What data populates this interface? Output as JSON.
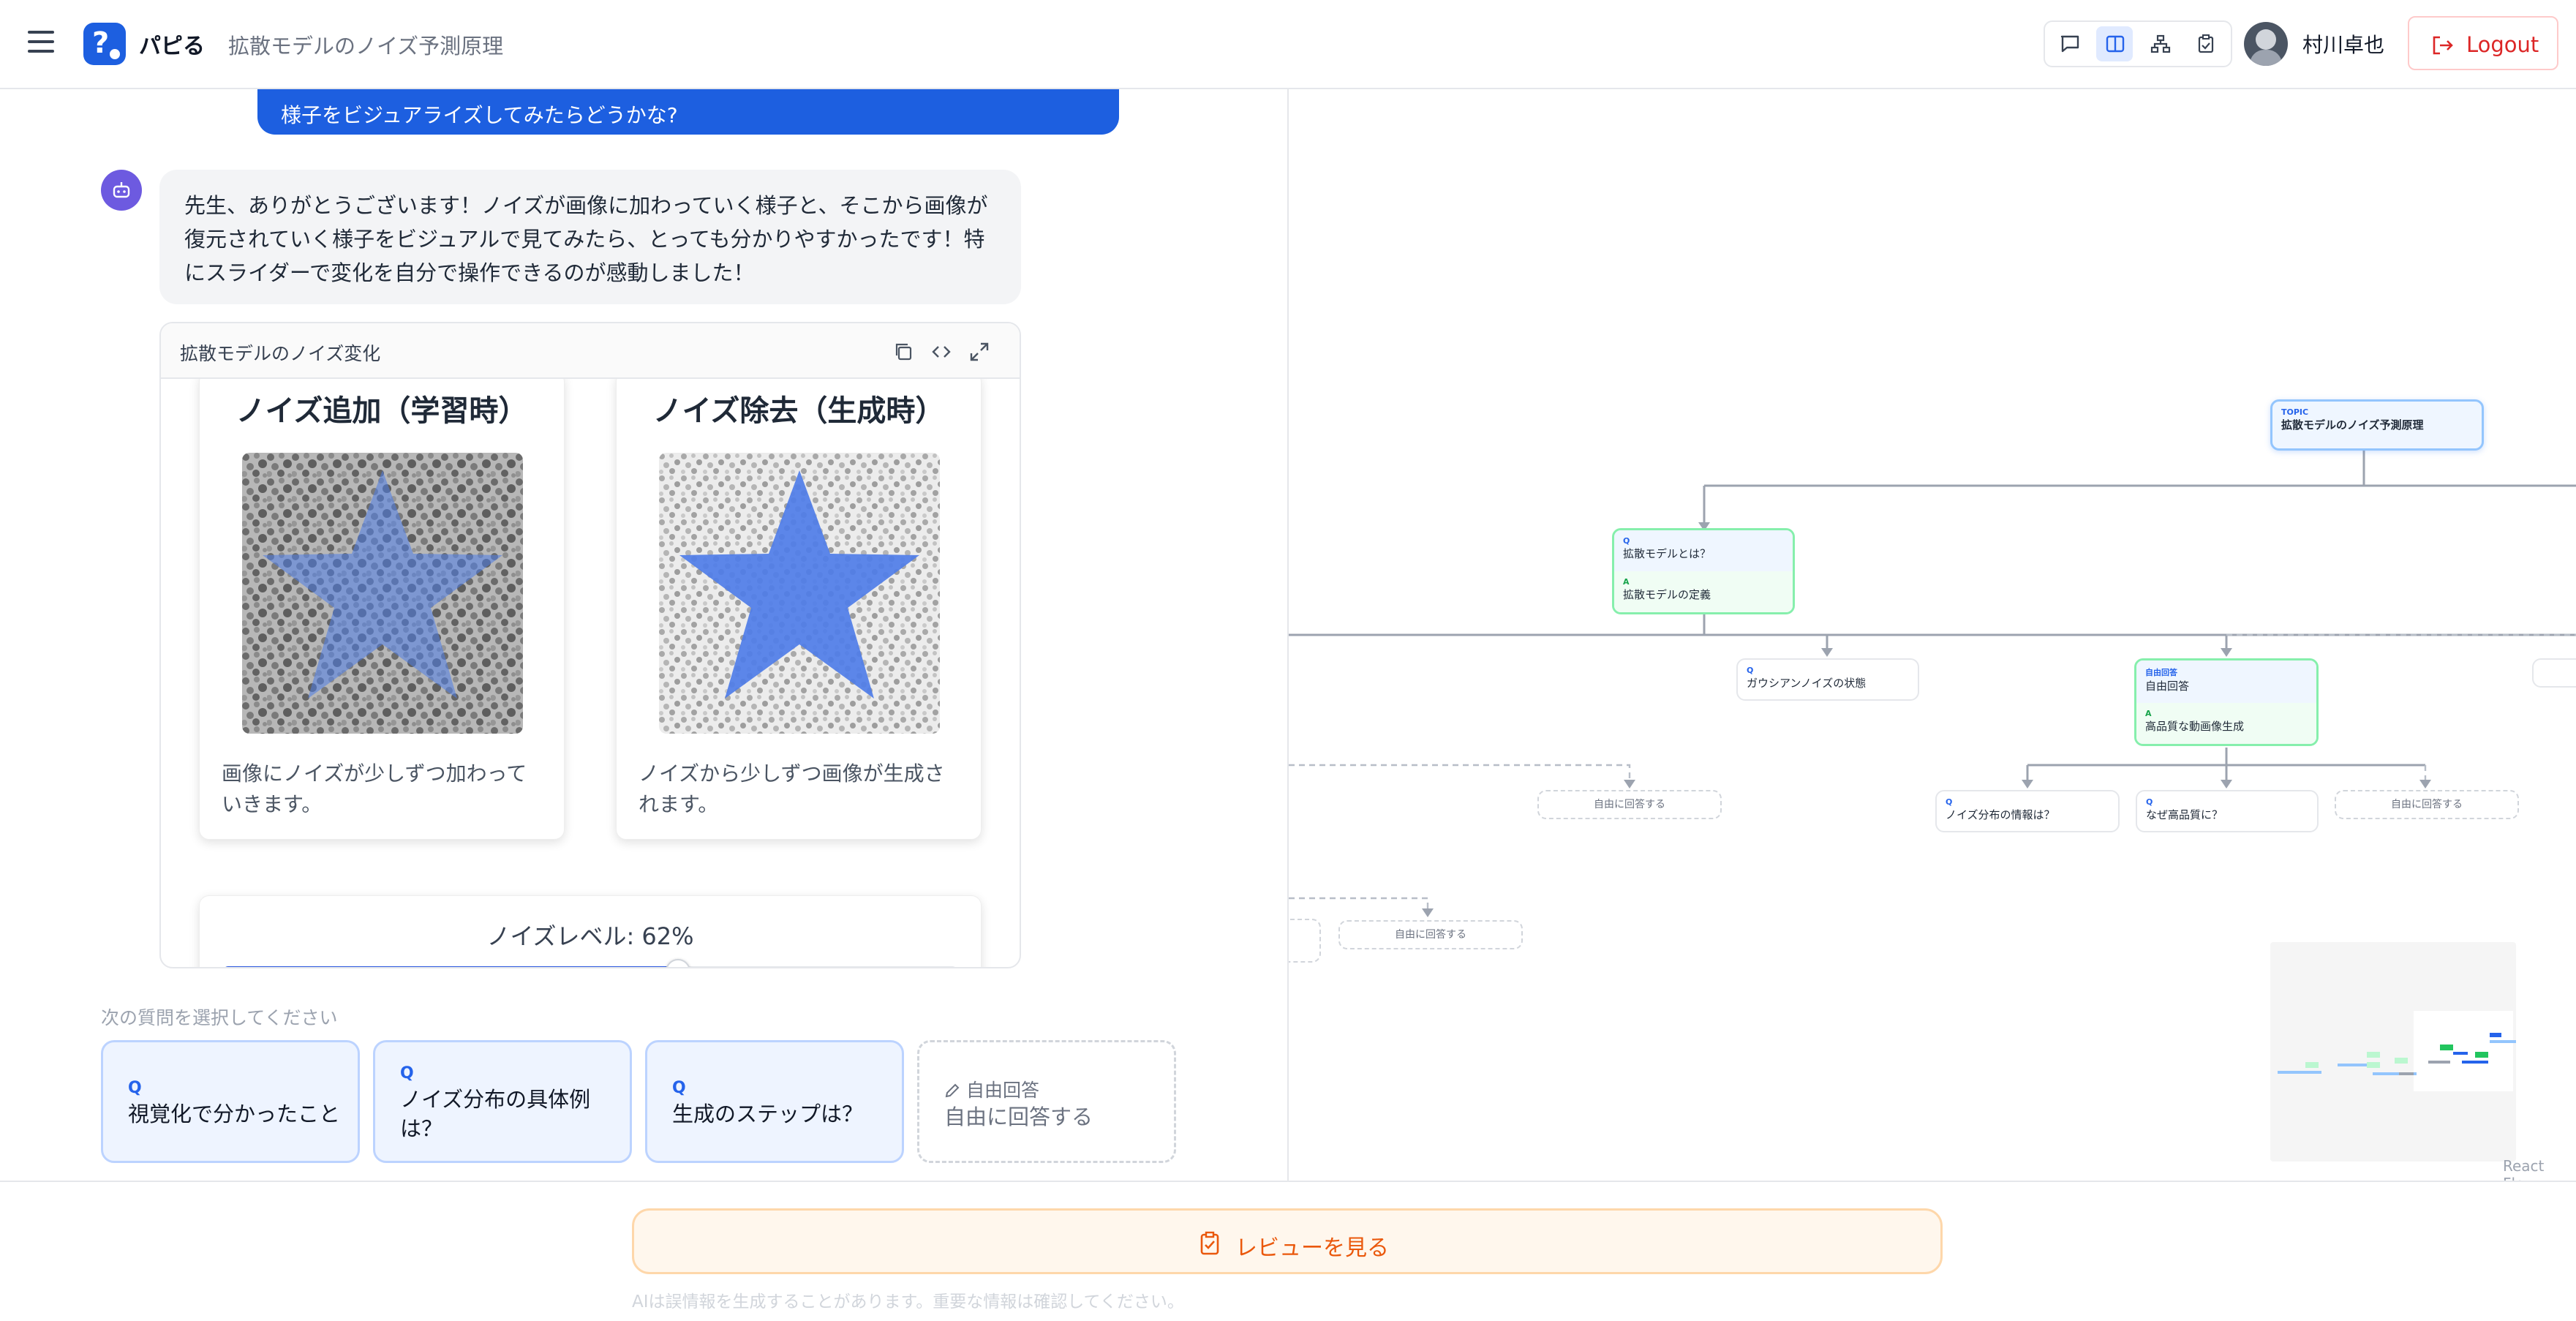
{
  "header": {
    "app_name": "パピる",
    "page_title": "拡散モデルのノイズ予測原理",
    "user_name": "村川卓也",
    "logout_label": "Logout"
  },
  "chat": {
    "user_message_tail": "様子をビジュアライズしてみたらどうかな?",
    "bot_message": "先生、ありがとうございます！ノイズが画像に加わっていく様子と、そこから画像が復元されていく様子をビジュアルで見てみたら、とっても分かりやすかったです！特にスライダーで変化を自分で操作できるのが感動しました！",
    "artifact": {
      "title": "拡散モデルのノイズ変化",
      "cards": [
        {
          "title": "ノイズ追加（学習時）",
          "desc": "画像にノイズが少しずつ加わっていきます。"
        },
        {
          "title": "ノイズ除去（生成時）",
          "desc": "ノイズから少しずつ画像が生成されます。"
        }
      ],
      "noise_level_label": "ノイズレベル: 62%",
      "noise_level": 0.62
    },
    "next_questions_label": "次の質問を選択してください",
    "next_questions": [
      {
        "tag": "Q",
        "text": "視覚化で分かったこと"
      },
      {
        "tag": "Q",
        "text": "ノイズ分布の具体例は？"
      },
      {
        "tag": "Q",
        "text": "生成のステップは？"
      }
    ],
    "free_answer": {
      "tag": "自由回答",
      "text": "自由に回答する"
    }
  },
  "flow": {
    "topic": {
      "tag": "TOPIC",
      "text": "拡散モデルのノイズ予測原理"
    },
    "node1": {
      "q_tag": "Q",
      "q": "拡散モデルとは？",
      "a_tag": "A",
      "a": "拡散モデルの定義"
    },
    "node2": {
      "q_tag": "Q",
      "q": "ガウシアンノイズの状態"
    },
    "node3": {
      "q_tag": "自由回答",
      "q": "自由回答",
      "a_tag": "A",
      "a": "高品質な動画像生成"
    },
    "node4": {
      "q_tag": "Q",
      "q": "ノイズ分布の情報は？"
    },
    "node5": {
      "q_tag": "Q",
      "q": "なぜ高品質に？"
    },
    "free_nodes": [
      "自由に回答する",
      "自由に回答する",
      "自由に回答する"
    ],
    "attribution": "React Flow"
  },
  "footer": {
    "review_label": "レビューを見る",
    "disclaimer": "AIは誤情報を生成することがあります。重要な情報は確認してください。"
  },
  "colors": {
    "accent": "#1d5fe0",
    "review": "#ea580c",
    "logout": "#dc2626"
  }
}
